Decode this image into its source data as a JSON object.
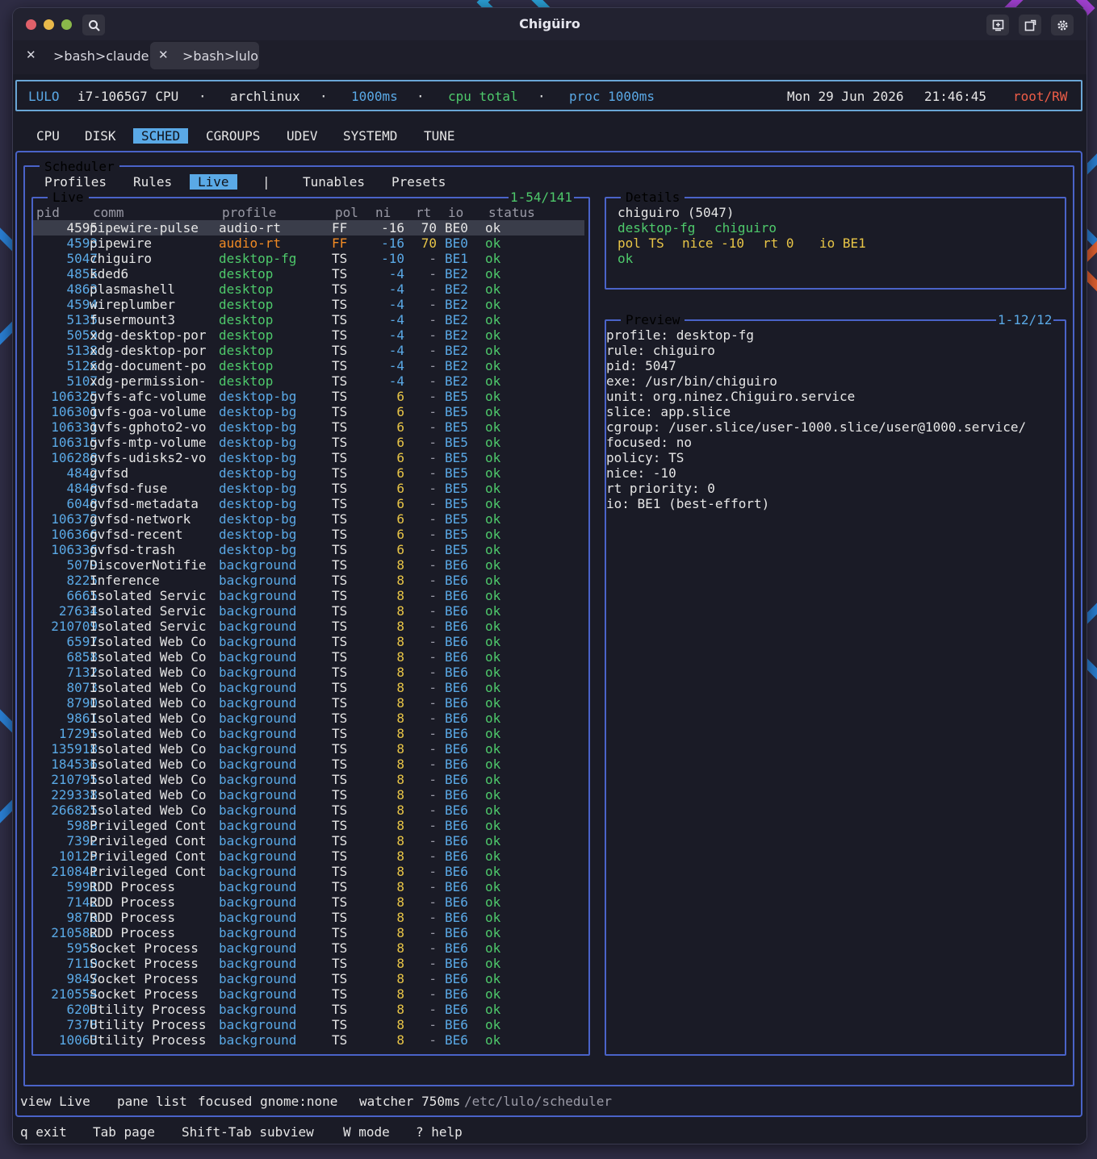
{
  "window": {
    "title": "Chigüiro",
    "tabs": [
      {
        "label": ">bash>claude",
        "close": "✕",
        "active": false
      },
      {
        "label": ">bash>lulo",
        "close": "✕",
        "active": true
      }
    ]
  },
  "header": {
    "app": "LULO",
    "cpu": "i7-1065G7 CPU",
    "sep": "·",
    "host": "archlinux",
    "interval": "1000ms",
    "cpu_mode": "cpu total",
    "proc": "proc 1000ms",
    "date": "Mon 29 Jun 2026",
    "time": "21:46:45",
    "mode": "root/RW"
  },
  "nav": {
    "tabs": [
      "CPU",
      "DISK",
      "SCHED",
      "CGROUPS",
      "UDEV",
      "SYSTEMD",
      "TUNE"
    ],
    "active": "SCHED"
  },
  "scheduler": {
    "title": "Scheduler",
    "subtabs": [
      "Profiles",
      "Rules",
      "Live"
    ],
    "active_subtab": "Live",
    "divider": "|",
    "subtabs_right": [
      "Tunables",
      "Presets"
    ]
  },
  "live": {
    "title": "Live",
    "range": "1-54/141",
    "columns": [
      "pid",
      "comm",
      "profile",
      "pol",
      "ni",
      "rt",
      "io",
      "status"
    ],
    "rows": [
      [
        "4595",
        "pipewire-pulse",
        "audio-rt",
        "FF",
        "-16",
        "70",
        "BE0",
        "ok"
      ],
      [
        "4593",
        "pipewire",
        "audio-rt",
        "FF",
        "-16",
        "70",
        "BE0",
        "ok"
      ],
      [
        "5047",
        "chiguiro",
        "desktop-fg",
        "TS",
        "-10",
        "-",
        "BE1",
        "ok"
      ],
      [
        "4855",
        "kded6",
        "desktop",
        "TS",
        "-4",
        "-",
        "BE2",
        "ok"
      ],
      [
        "4863",
        "plasmashell",
        "desktop",
        "TS",
        "-4",
        "-",
        "BE2",
        "ok"
      ],
      [
        "4594",
        "wireplumber",
        "desktop",
        "TS",
        "-4",
        "-",
        "BE2",
        "ok"
      ],
      [
        "5135",
        "fusermount3",
        "desktop",
        "TS",
        "-4",
        "-",
        "BE2",
        "ok"
      ],
      [
        "5059",
        "xdg-desktop-por",
        "desktop",
        "TS",
        "-4",
        "-",
        "BE2",
        "ok"
      ],
      [
        "5138",
        "xdg-desktop-por",
        "desktop",
        "TS",
        "-4",
        "-",
        "BE2",
        "ok"
      ],
      [
        "5126",
        "xdg-document-po",
        "desktop",
        "TS",
        "-4",
        "-",
        "BE2",
        "ok"
      ],
      [
        "5107",
        "xdg-permission-",
        "desktop",
        "TS",
        "-4",
        "-",
        "BE2",
        "ok"
      ],
      [
        "106325",
        "gvfs-afc-volume",
        "desktop-bg",
        "TS",
        "6",
        "-",
        "BE5",
        "ok"
      ],
      [
        "106301",
        "gvfs-goa-volume",
        "desktop-bg",
        "TS",
        "6",
        "-",
        "BE5",
        "ok"
      ],
      [
        "106331",
        "gvfs-gphoto2-vo",
        "desktop-bg",
        "TS",
        "6",
        "-",
        "BE5",
        "ok"
      ],
      [
        "106315",
        "gvfs-mtp-volume",
        "desktop-bg",
        "TS",
        "6",
        "-",
        "BE5",
        "ok"
      ],
      [
        "106288",
        "gvfs-udisks2-vo",
        "desktop-bg",
        "TS",
        "6",
        "-",
        "BE5",
        "ok"
      ],
      [
        "4842",
        "gvfsd",
        "desktop-bg",
        "TS",
        "6",
        "-",
        "BE5",
        "ok"
      ],
      [
        "4848",
        "gvfsd-fuse",
        "desktop-bg",
        "TS",
        "6",
        "-",
        "BE5",
        "ok"
      ],
      [
        "6048",
        "gvfsd-metadata",
        "desktop-bg",
        "TS",
        "6",
        "-",
        "BE5",
        "ok"
      ],
      [
        "106372",
        "gvfsd-network",
        "desktop-bg",
        "TS",
        "6",
        "-",
        "BE5",
        "ok"
      ],
      [
        "106366",
        "gvfsd-recent",
        "desktop-bg",
        "TS",
        "6",
        "-",
        "BE5",
        "ok"
      ],
      [
        "106336",
        "gvfsd-trash",
        "desktop-bg",
        "TS",
        "6",
        "-",
        "BE5",
        "ok"
      ],
      [
        "5079",
        "DiscoverNotifie",
        "background",
        "TS",
        "8",
        "-",
        "BE6",
        "ok"
      ],
      [
        "8225",
        "Inference",
        "background",
        "TS",
        "8",
        "-",
        "BE6",
        "ok"
      ],
      [
        "6665",
        "Isolated Servic",
        "background",
        "TS",
        "8",
        "-",
        "BE6",
        "ok"
      ],
      [
        "27634",
        "Isolated Servic",
        "background",
        "TS",
        "8",
        "-",
        "BE6",
        "ok"
      ],
      [
        "210709",
        "Isolated Servic",
        "background",
        "TS",
        "8",
        "-",
        "BE6",
        "ok"
      ],
      [
        "6597",
        "Isolated Web Co",
        "background",
        "TS",
        "8",
        "-",
        "BE6",
        "ok"
      ],
      [
        "6858",
        "Isolated Web Co",
        "background",
        "TS",
        "8",
        "-",
        "BE6",
        "ok"
      ],
      [
        "7132",
        "Isolated Web Co",
        "background",
        "TS",
        "8",
        "-",
        "BE6",
        "ok"
      ],
      [
        "8073",
        "Isolated Web Co",
        "background",
        "TS",
        "8",
        "-",
        "BE6",
        "ok"
      ],
      [
        "8790",
        "Isolated Web Co",
        "background",
        "TS",
        "8",
        "-",
        "BE6",
        "ok"
      ],
      [
        "9861",
        "Isolated Web Co",
        "background",
        "TS",
        "8",
        "-",
        "BE6",
        "ok"
      ],
      [
        "17295",
        "Isolated Web Co",
        "background",
        "TS",
        "8",
        "-",
        "BE6",
        "ok"
      ],
      [
        "135918",
        "Isolated Web Co",
        "background",
        "TS",
        "8",
        "-",
        "BE6",
        "ok"
      ],
      [
        "184536",
        "Isolated Web Co",
        "background",
        "TS",
        "8",
        "-",
        "BE6",
        "ok"
      ],
      [
        "210795",
        "Isolated Web Co",
        "background",
        "TS",
        "8",
        "-",
        "BE6",
        "ok"
      ],
      [
        "229338",
        "Isolated Web Co",
        "background",
        "TS",
        "8",
        "-",
        "BE6",
        "ok"
      ],
      [
        "266825",
        "Isolated Web Co",
        "background",
        "TS",
        "8",
        "-",
        "BE6",
        "ok"
      ],
      [
        "5983",
        "Privileged Cont",
        "background",
        "TS",
        "8",
        "-",
        "BE6",
        "ok"
      ],
      [
        "7392",
        "Privileged Cont",
        "background",
        "TS",
        "8",
        "-",
        "BE6",
        "ok"
      ],
      [
        "10125",
        "Privileged Cont",
        "background",
        "TS",
        "8",
        "-",
        "BE6",
        "ok"
      ],
      [
        "210841",
        "Privileged Cont",
        "background",
        "TS",
        "8",
        "-",
        "BE6",
        "ok"
      ],
      [
        "5991",
        "RDD Process",
        "background",
        "TS",
        "8",
        "-",
        "BE6",
        "ok"
      ],
      [
        "7142",
        "RDD Process",
        "background",
        "TS",
        "8",
        "-",
        "BE6",
        "ok"
      ],
      [
        "9870",
        "RDD Process",
        "background",
        "TS",
        "8",
        "-",
        "BE6",
        "ok"
      ],
      [
        "210582",
        "RDD Process",
        "background",
        "TS",
        "8",
        "-",
        "BE6",
        "ok"
      ],
      [
        "5958",
        "Socket Process",
        "background",
        "TS",
        "8",
        "-",
        "BE6",
        "ok"
      ],
      [
        "7110",
        "Socket Process",
        "background",
        "TS",
        "8",
        "-",
        "BE6",
        "ok"
      ],
      [
        "9847",
        "Socket Process",
        "background",
        "TS",
        "8",
        "-",
        "BE6",
        "ok"
      ],
      [
        "210554",
        "Socket Process",
        "background",
        "TS",
        "8",
        "-",
        "BE6",
        "ok"
      ],
      [
        "6203",
        "Utility Process",
        "background",
        "TS",
        "8",
        "-",
        "BE6",
        "ok"
      ],
      [
        "7378",
        "Utility Process",
        "background",
        "TS",
        "8",
        "-",
        "BE6",
        "ok"
      ],
      [
        "10063",
        "Utility Process",
        "background",
        "TS",
        "8",
        "-",
        "BE6",
        "ok"
      ]
    ]
  },
  "details": {
    "title": "Details",
    "name": "chiguiro (5047)",
    "profile": "desktop-fg",
    "rule": "chiguiro",
    "pol": "pol TS",
    "nice": "nice -10",
    "rt": "rt 0",
    "io": "io BE1",
    "status": "ok"
  },
  "preview": {
    "title": "Preview",
    "range": "1-12/12",
    "lines": [
      "profile: desktop-fg",
      "rule: chiguiro",
      "pid: 5047",
      "exe: /usr/bin/chiguiro",
      "unit: org.ninez.Chiguiro.service",
      "slice: app.slice",
      "cgroup: /user.slice/user-1000.slice/user@1000.service/",
      "focused: no",
      "policy: TS",
      "nice: -10",
      "rt priority: 0",
      "io: BE1 (best-effort)"
    ]
  },
  "status": {
    "view": "view Live",
    "pane": "pane list",
    "focused": "focused gnome:none",
    "watcher": "watcher 750ms",
    "path": "/etc/lulo/scheduler"
  },
  "footer": {
    "keys": [
      "q exit",
      "Tab page",
      "Shift-Tab subview",
      "W mode",
      "? help"
    ]
  },
  "colors": {
    "accent_blue": "#5aa9e6",
    "green": "#4ec96b",
    "orange": "#f08a24",
    "yellow": "#e8c547",
    "red": "#ee5d47",
    "border_blue": "#4a63c8",
    "header_border": "#6aa6d6"
  }
}
